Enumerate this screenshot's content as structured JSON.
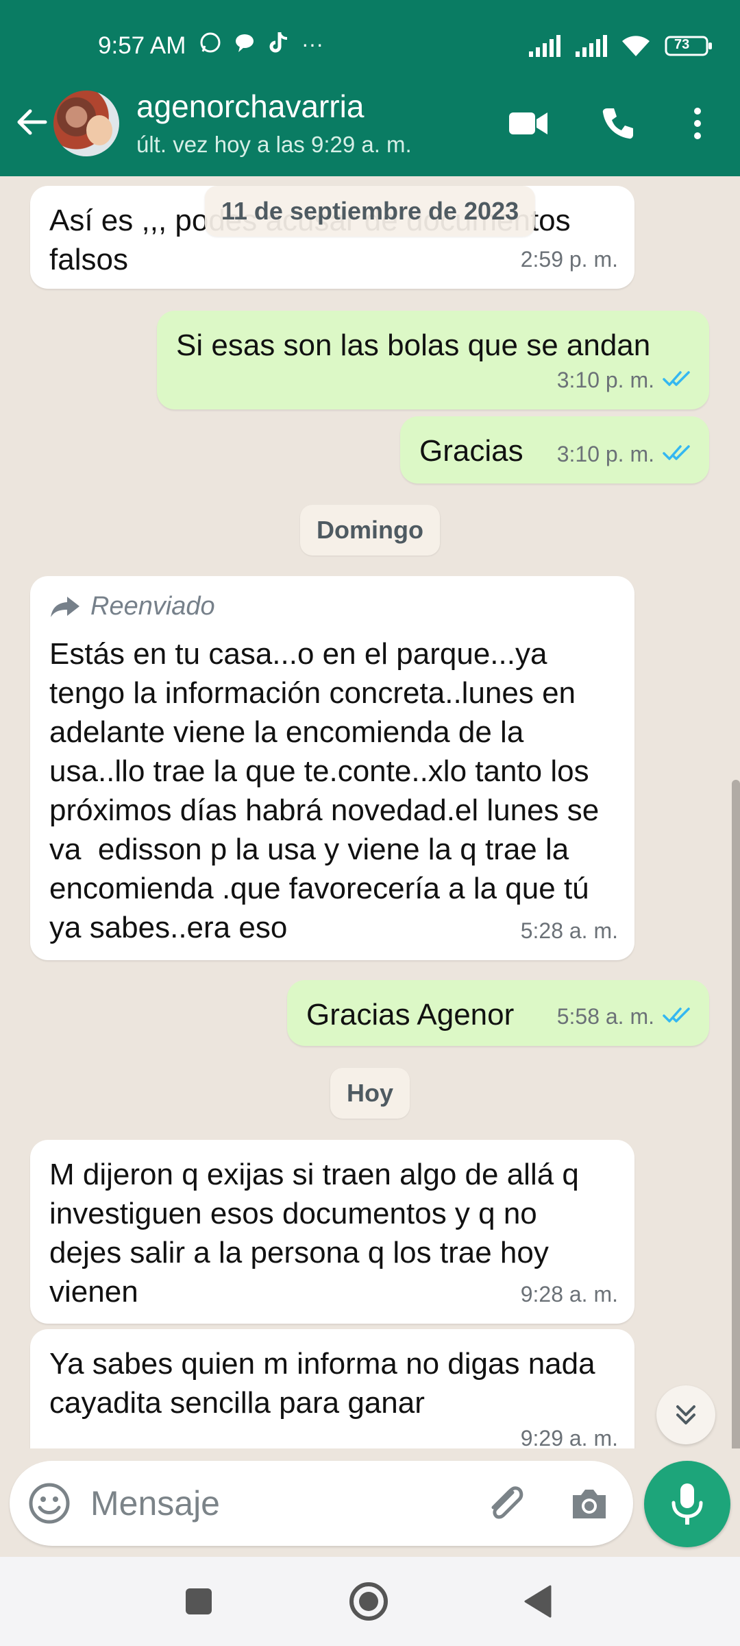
{
  "status_bar": {
    "time": "9:57 AM",
    "battery": "73",
    "more": "···"
  },
  "header": {
    "contact_name": "agenorchavarria",
    "last_seen": "últ. vez hoy a las 9:29 a. m."
  },
  "chat": {
    "floating_date": "11 de septiembre de 2023",
    "messages": [
      {
        "direction": "in",
        "text": "Así es ,,, podes acusar de documentos falsos",
        "time": "2:59 p. m."
      },
      {
        "direction": "out",
        "text": "Si esas son las bolas que se andan",
        "time": "3:10 p. m.",
        "status": "read"
      },
      {
        "direction": "out",
        "text": "Gracias",
        "time": "3:10 p. m.",
        "status": "read"
      },
      {
        "direction": "in",
        "forwarded_label": "Reenviado",
        "text": "Estás en tu casa...o en el parque...ya tengo la información concreta..lunes en adelante viene la encomienda de la usa..llo trae la que te.conte..xlo tanto los próximos días habrá novedad.el lunes se va  edisson p la usa y viene la q trae la encomienda .que favorecería a la que tú ya sabes..era eso",
        "time": "5:28 a. m."
      },
      {
        "direction": "out",
        "text": "Gracias Agenor",
        "time": "5:58 a. m.",
        "status": "read"
      },
      {
        "direction": "in",
        "text": "M dijeron q exijas si traen algo de allá q investiguen esos documentos y q no dejes salir a la persona q los trae hoy vienen",
        "time": "9:28 a. m."
      },
      {
        "direction": "in",
        "text": "Ya sabes quien m informa no digas nada cayadita sencilla para ganar",
        "time": "9:29 a. m."
      }
    ],
    "day_separators": {
      "sunday": "Domingo",
      "today": "Hoy"
    }
  },
  "composer": {
    "placeholder": "Mensaje"
  },
  "colors": {
    "header": "#0a7c63",
    "outgoing": "#dcf8c6",
    "incoming": "#ffffff",
    "accent": "#1da57a",
    "read_ticks": "#34b7f1"
  },
  "icons": [
    "back-arrow-icon",
    "video-call-icon",
    "phone-icon",
    "more-vert-icon",
    "emoji-icon",
    "paperclip-icon",
    "camera-icon",
    "mic-icon",
    "forward-icon",
    "double-check-icon",
    "chevron-double-down-icon"
  ]
}
